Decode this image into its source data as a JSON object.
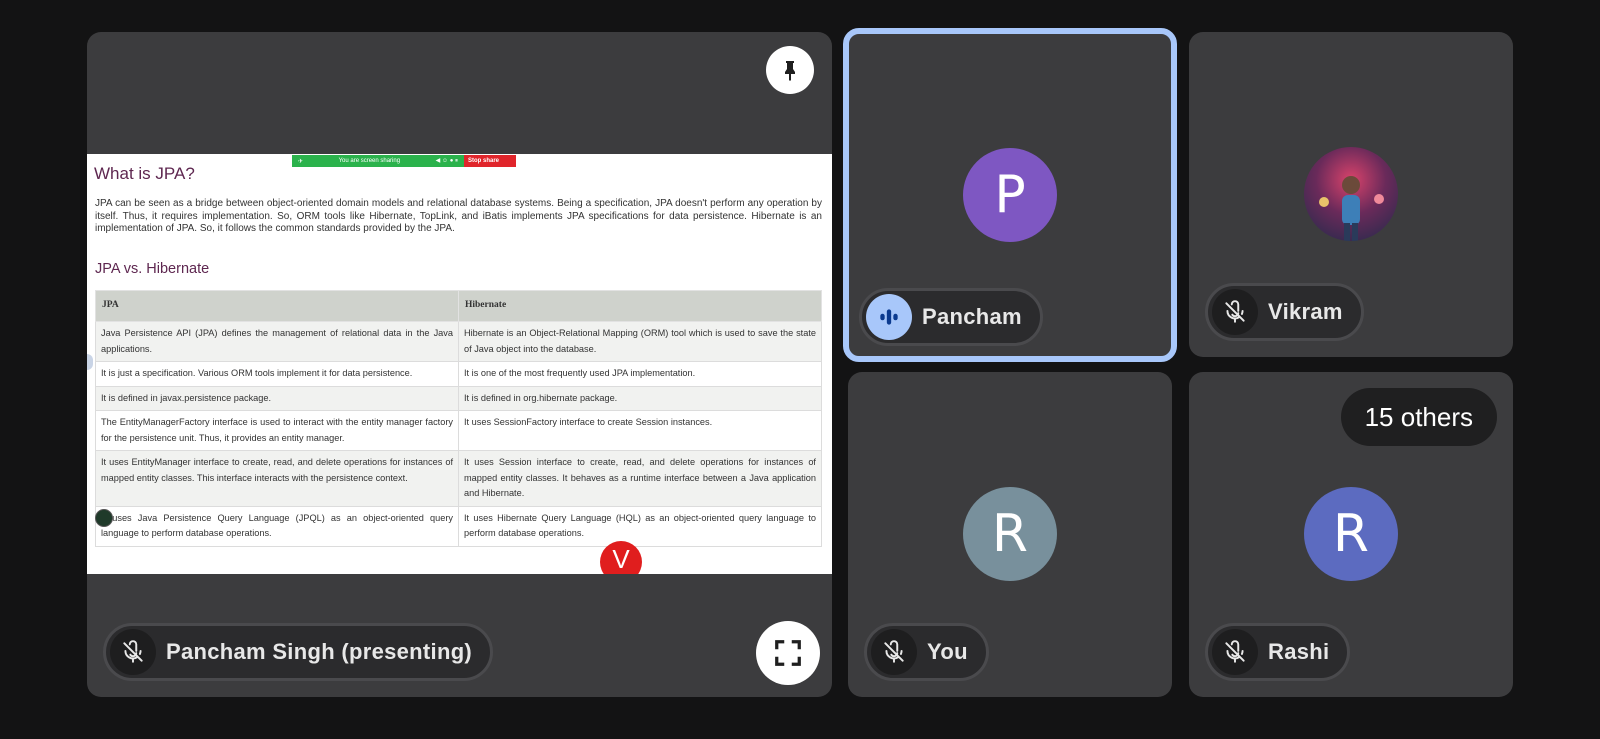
{
  "presenter": {
    "name": "Pancham Singh (presenting)",
    "muted": true,
    "pin_icon": "pin-icon",
    "fullscreen_icon": "fullscreen-icon"
  },
  "shared_screen": {
    "share_bar": {
      "status": "You are screen sharing",
      "stop_label": "Stop share"
    },
    "heading": "What is JPA?",
    "intro": "JPA can be seen as a bridge between object-oriented domain models and relational database systems. Being a specification, JPA doesn't perform any operation by itself. Thus, it requires implementation. So, ORM tools like Hibernate, TopLink, and iBatis implements JPA specifications for data persistence. Hibernate is an implementation of JPA. So, it follows the common standards provided by the JPA.",
    "subheading": "JPA vs. Hibernate",
    "table": {
      "headers": [
        "JPA",
        "Hibernate"
      ],
      "rows": [
        [
          "Java Persistence API (JPA) defines the management of relational data in the Java applications.",
          "Hibernate is an Object-Relational Mapping (ORM) tool which is used to save the state of Java object into the database."
        ],
        [
          "It is just a specification. Various ORM tools implement it for data persistence.",
          "It is one of the most frequently used JPA implementation."
        ],
        [
          "It is defined in javax.persistence package.",
          "It is defined in org.hibernate package."
        ],
        [
          "The EntityManagerFactory interface is used to interact with the entity manager factory for the persistence unit. Thus, it provides an entity manager.",
          "It uses SessionFactory interface to create Session instances."
        ],
        [
          "It uses EntityManager interface to create, read, and delete operations for instances of mapped entity classes. This interface interacts with the persistence context.",
          "It uses Session interface to create, read, and delete operations for instances of mapped entity classes. It behaves as a runtime interface between a Java application and Hibernate."
        ],
        [
          "It uses Java Persistence Query Language (JPQL) as an object-oriented query language to perform database operations.",
          "It uses Hibernate Query Language (HQL) as an object-oriented query language to perform database operations."
        ]
      ]
    },
    "overlay_letter": "V"
  },
  "participants": [
    {
      "id": "pancham",
      "name": "Pancham",
      "initial": "P",
      "avatar_color": "#7e57c2",
      "speaking": true,
      "muted": false
    },
    {
      "id": "vikram",
      "name": "Vikram",
      "initial": "",
      "avatar_color": "#6a4a8c",
      "speaking": false,
      "muted": true
    },
    {
      "id": "you",
      "name": "You",
      "initial": "R",
      "avatar_color": "#78909c",
      "speaking": false,
      "muted": true
    },
    {
      "id": "rashi",
      "name": "Rashi",
      "initial": "R",
      "avatar_color": "#5c6bc0",
      "speaking": false,
      "muted": true
    }
  ],
  "others_count_label": "15 others",
  "colors": {
    "background": "#131314",
    "tile": "#3c3c3e",
    "active_border": "#a8c7fa"
  }
}
